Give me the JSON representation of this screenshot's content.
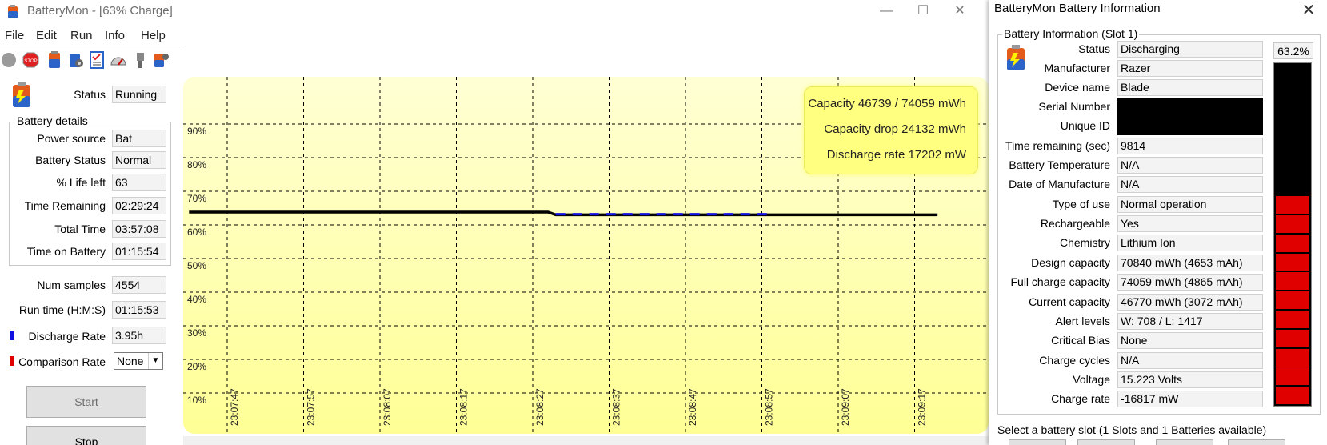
{
  "main": {
    "title": "BatteryMon - [63% Charge]",
    "menu": [
      "File",
      "Edit",
      "Run",
      "Info",
      "Help"
    ],
    "toolbar_icons": [
      "record-icon",
      "stop-icon",
      "battery-icon",
      "battery-settings-icon",
      "checklist-icon",
      "gauge-icon",
      "plug-icon",
      "battery-config-icon"
    ],
    "status_label": "Status",
    "status_value": "Running",
    "details_group": "Battery details",
    "details": [
      {
        "label": "Power source",
        "value": "Bat"
      },
      {
        "label": "Battery Status",
        "value": "Normal"
      },
      {
        "label": "% Life left",
        "value": "63"
      },
      {
        "label": "Time Remaining",
        "value": "02:29:24"
      },
      {
        "label": "Total Time",
        "value": "03:57:08"
      },
      {
        "label": "Time on Battery",
        "value": "01:15:54"
      }
    ],
    "num_samples_label": "Num samples",
    "num_samples_value": "4554",
    "run_time_label": "Run time (H:M:S)",
    "run_time_value": "01:15:53",
    "discharge_rate_label": "Discharge Rate",
    "discharge_rate_value": "3.95h",
    "comparison_rate_label": "Comparison Rate",
    "comparison_rate_value": "None",
    "start_label": "Start",
    "stop_label": "Stop",
    "colors": {
      "discharge": "#1010e0",
      "comparison": "#e00000",
      "chart_bg": "#ffffcc"
    }
  },
  "overlay": {
    "capacity": "Capacity 46739 / 74059 mWh",
    "capacity_drop": "Capacity drop 24132 mWh",
    "discharge_rate": "Discharge rate 17202 mW"
  },
  "chart_data": {
    "type": "line",
    "y_tick_labels": [
      "90%",
      "80%",
      "70%",
      "60%",
      "50%",
      "40%",
      "30%",
      "20%",
      "10%"
    ],
    "x_tick_labels": [
      "23:07:47",
      "23:07:57",
      "23:08:07",
      "23:08:17",
      "23:08:27",
      "23:08:37",
      "23:08:47",
      "23:08:57",
      "23:09:07",
      "23:09:17"
    ],
    "ylim": [
      5,
      95
    ],
    "grid": true,
    "series": [
      {
        "values": [
          {
            "x": "23:07:42",
            "y": 63.8
          },
          {
            "x": "23:08:29",
            "y": 63.8
          },
          {
            "x": "23:08:30",
            "y": 63.0
          },
          {
            "x": "23:09:20",
            "y": 63.0
          }
        ]
      },
      {
        "values": [
          {
            "x": "23:08:30",
            "y": 63.2
          },
          {
            "x": "23:08:58",
            "y": 63.2
          }
        ]
      }
    ]
  },
  "info": {
    "title": "BatteryMon Battery Information",
    "group": "Battery Information (Slot 1)",
    "percent": "63.2%",
    "percent_value": 0.632,
    "fields": [
      {
        "label": "Status",
        "value": "Discharging"
      },
      {
        "label": "Manufacturer",
        "value": "Razer"
      },
      {
        "label": "Device name",
        "value": "Blade"
      },
      {
        "label": "Serial Number",
        "value": ""
      },
      {
        "label": "Unique ID",
        "value": ""
      },
      {
        "label": "Time remaining (sec)",
        "value": "9814"
      },
      {
        "label": "Battery Temperature",
        "value": "N/A"
      },
      {
        "label": "Date of Manufacture",
        "value": "N/A"
      },
      {
        "label": "Type of use",
        "value": "Normal operation"
      },
      {
        "label": "Rechargeable",
        "value": "Yes"
      },
      {
        "label": "Chemistry",
        "value": "Lithium Ion"
      },
      {
        "label": "Design capacity",
        "value": "70840 mWh (4653 mAh)"
      },
      {
        "label": "Full charge capacity",
        "value": "74059 mWh (4865 mAh)"
      },
      {
        "label": "Current capacity",
        "value": "46770 mWh (3072 mAh)"
      },
      {
        "label": "Alert levels",
        "value": "W: 708 / L: 1417"
      },
      {
        "label": "Critical Bias",
        "value": "None"
      },
      {
        "label": "Charge cycles",
        "value": "N/A"
      },
      {
        "label": "Voltage",
        "value": "15.223 Volts"
      },
      {
        "label": "Charge rate",
        "value": "-16817 mW"
      }
    ],
    "slot_prompt": "Select a battery slot (1 Slots and 1 Batteries available)"
  }
}
